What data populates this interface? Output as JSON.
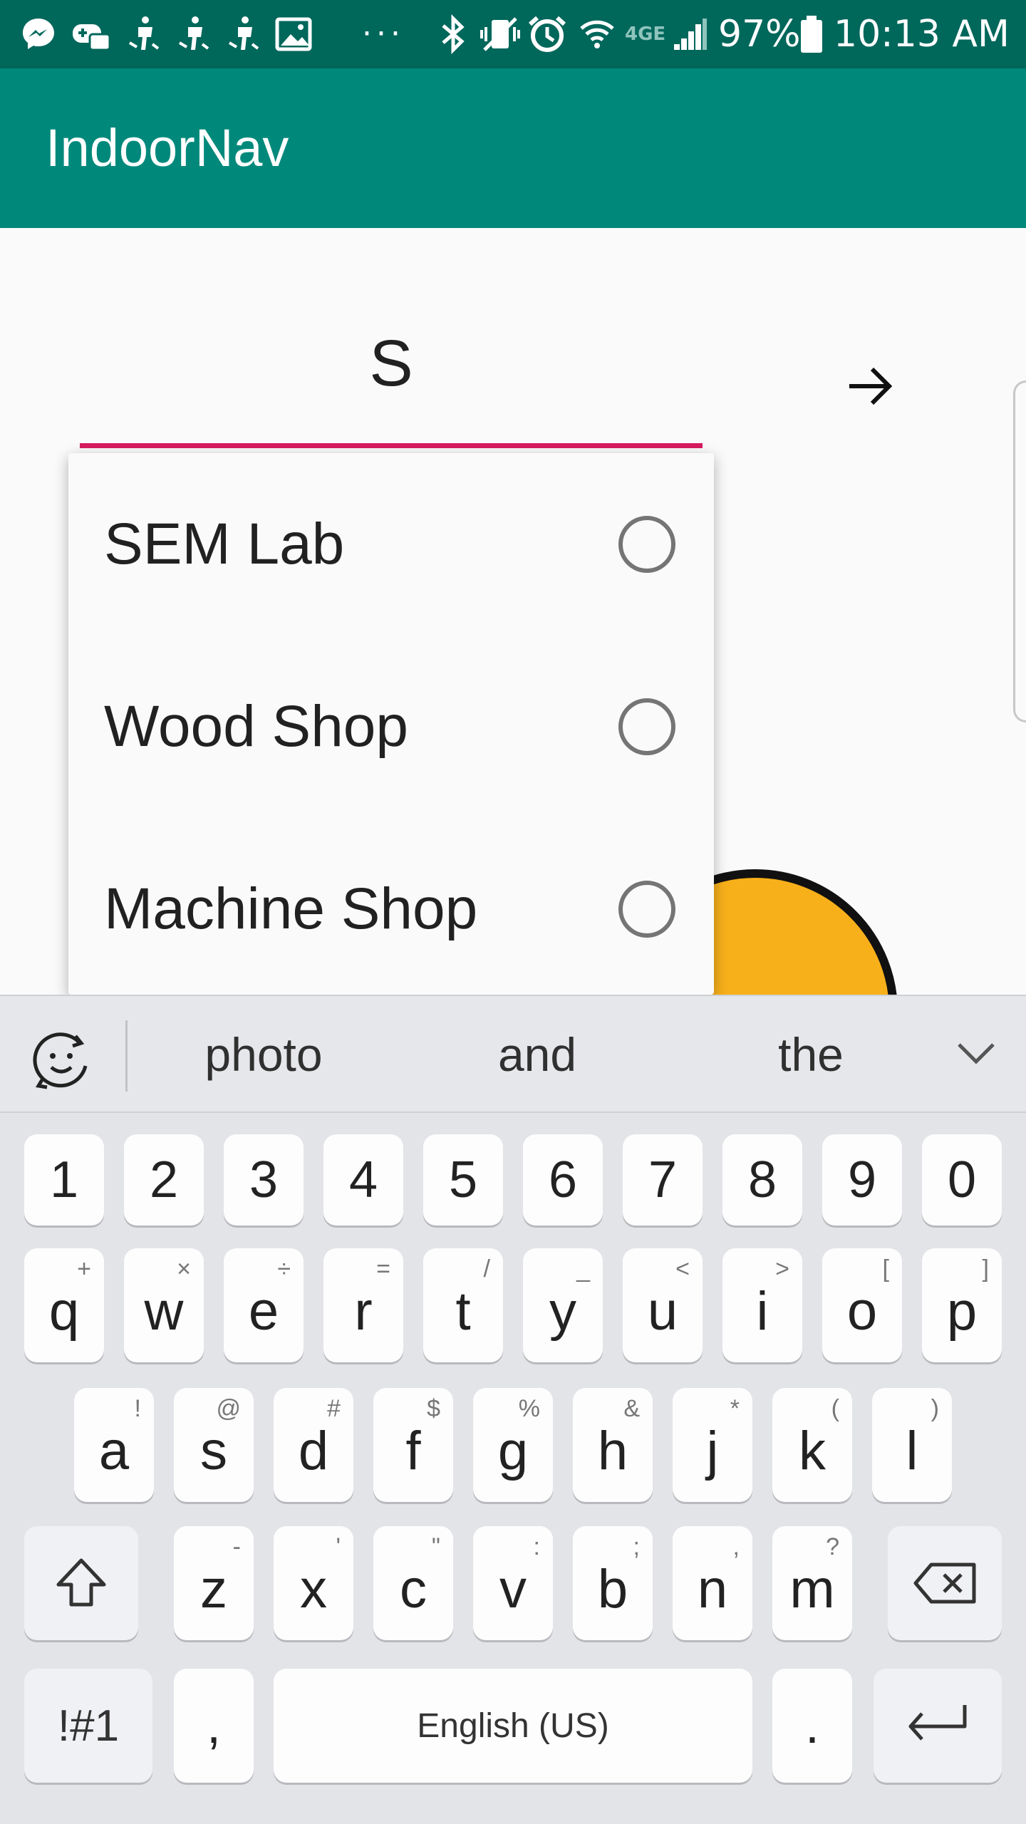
{
  "status_bar": {
    "left_icons": [
      "messenger-icon",
      "gamepad-icon",
      "accessibility-icon",
      "accessibility-icon",
      "accessibility-icon",
      "image-icon"
    ],
    "more": "···",
    "right_icons": [
      "bluetooth-icon",
      "vibrate-icon",
      "alarm-icon",
      "wifi-icon",
      "lte-icon",
      "signal-icon"
    ],
    "battery": "97%",
    "time": "10:13 AM"
  },
  "app_bar": {
    "title": "IndoorNav"
  },
  "search": {
    "value": "S"
  },
  "dropdown": {
    "items": [
      {
        "label": "SEM Lab",
        "selected": false
      },
      {
        "label": "Wood Shop",
        "selected": false
      },
      {
        "label": "Machine Shop",
        "selected": false
      }
    ]
  },
  "keyboard": {
    "suggestions": [
      "photo",
      "and",
      "the"
    ],
    "number_row": [
      "1",
      "2",
      "3",
      "4",
      "5",
      "6",
      "7",
      "8",
      "9",
      "0"
    ],
    "row1": [
      {
        "k": "q",
        "s": "+"
      },
      {
        "k": "w",
        "s": "×"
      },
      {
        "k": "e",
        "s": "÷"
      },
      {
        "k": "r",
        "s": "="
      },
      {
        "k": "t",
        "s": "/"
      },
      {
        "k": "y",
        "s": "_"
      },
      {
        "k": "u",
        "s": "<"
      },
      {
        "k": "i",
        "s": ">"
      },
      {
        "k": "o",
        "s": "["
      },
      {
        "k": "p",
        "s": "]"
      }
    ],
    "row2": [
      {
        "k": "a",
        "s": "!"
      },
      {
        "k": "s",
        "s": "@"
      },
      {
        "k": "d",
        "s": "#"
      },
      {
        "k": "f",
        "s": "$"
      },
      {
        "k": "g",
        "s": "%"
      },
      {
        "k": "h",
        "s": "&"
      },
      {
        "k": "j",
        "s": "*"
      },
      {
        "k": "k",
        "s": "("
      },
      {
        "k": "l",
        "s": ")"
      }
    ],
    "row3": [
      {
        "k": "z",
        "s": "-"
      },
      {
        "k": "x",
        "s": "'"
      },
      {
        "k": "c",
        "s": "\""
      },
      {
        "k": "v",
        "s": ":"
      },
      {
        "k": "b",
        "s": ";"
      },
      {
        "k": "n",
        "s": ","
      },
      {
        "k": "m",
        "s": "?"
      }
    ],
    "symbols_label": "!#1",
    "comma": ",",
    "space_label": "English (US)",
    "period": "."
  },
  "colors": {
    "status_bar": "#00675b",
    "app_bar": "#00897b",
    "accent_underline": "#d81b60",
    "marker": "#f8b01a"
  }
}
